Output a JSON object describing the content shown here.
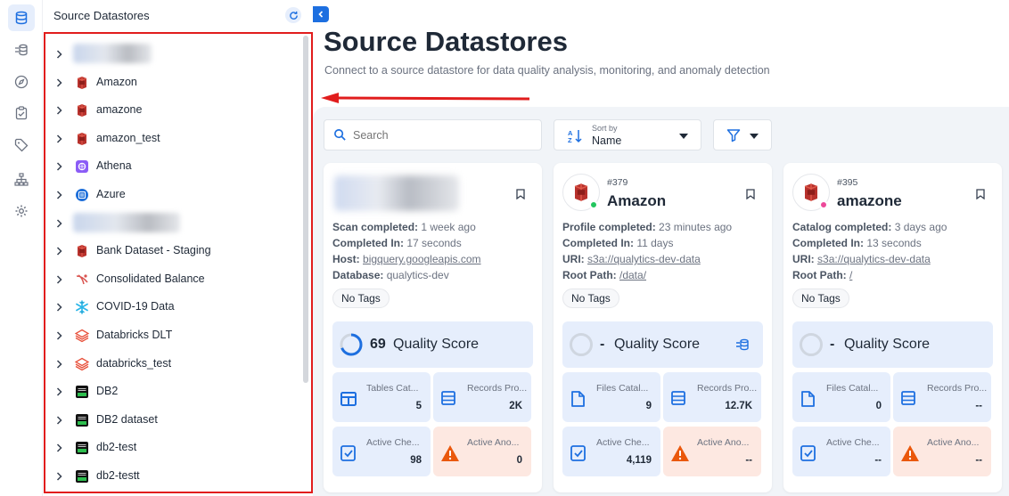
{
  "rail": {
    "items": [
      {
        "icon": "database-icon"
      },
      {
        "icon": "data-flow-icon"
      },
      {
        "icon": "compass-icon"
      },
      {
        "icon": "clipboard-check-icon"
      },
      {
        "icon": "tag-icon"
      },
      {
        "icon": "hierarchy-icon"
      },
      {
        "icon": "settings-gear-icon"
      }
    ]
  },
  "sidebar": {
    "title": "Source Datastores",
    "items": [
      {
        "label": "",
        "icon": "blurred",
        "redacted": true
      },
      {
        "label": "Amazon",
        "icon": "amazon-s3-icon"
      },
      {
        "label": "amazone",
        "icon": "amazon-s3-icon"
      },
      {
        "label": "amazon_test",
        "icon": "amazon-s3-icon"
      },
      {
        "label": "Athena",
        "icon": "athena-icon"
      },
      {
        "label": "Azure",
        "icon": "azure-icon"
      },
      {
        "label": "",
        "icon": "blurred",
        "redacted": true
      },
      {
        "label": "Bank Dataset - Staging",
        "icon": "amazon-s3-icon"
      },
      {
        "label": "Consolidated Balance",
        "icon": "dremio-icon"
      },
      {
        "label": "COVID-19 Data",
        "icon": "snowflake-icon"
      },
      {
        "label": "Databricks DLT",
        "icon": "databricks-icon"
      },
      {
        "label": "databricks_test",
        "icon": "databricks-icon"
      },
      {
        "label": "DB2",
        "icon": "ibm-db2-icon"
      },
      {
        "label": "DB2 dataset",
        "icon": "ibm-db2-icon"
      },
      {
        "label": "db2-test",
        "icon": "ibm-db2-icon"
      },
      {
        "label": "db2-testt",
        "icon": "ibm-db2-icon"
      }
    ]
  },
  "main": {
    "title": "Source Datastores",
    "subtitle": "Connect to a source datastore for data quality analysis, monitoring, and anomaly detection",
    "search": {
      "placeholder": "Search"
    },
    "sort": {
      "label": "Sort by",
      "value": "Name"
    }
  },
  "cards": [
    {
      "number": "",
      "name": "",
      "redacted": true,
      "status_color": "",
      "lines": [
        {
          "key": "Scan completed:",
          "value": "1 week ago",
          "link": false
        },
        {
          "key": "Completed In:",
          "value": "17 seconds",
          "link": false
        },
        {
          "key": "Host:",
          "value": "bigquery.googleapis.com",
          "link": true
        },
        {
          "key": "Database:",
          "value": "qualytics-dev",
          "link": false
        }
      ],
      "tag": "No Tags",
      "quality_value": "69",
      "quality_label": "Quality Score",
      "quality_fraction": 0.69,
      "tiles": [
        {
          "icon": "table-icon",
          "label": "Tables Cat...",
          "value": "5"
        },
        {
          "icon": "records-icon",
          "label": "Records Pro...",
          "value": "2K"
        },
        {
          "icon": "check-icon",
          "label": "Active Che...",
          "value": "98"
        },
        {
          "icon": "warning-icon",
          "label": "Active Ano...",
          "value": "0"
        }
      ]
    },
    {
      "number": "#379",
      "name": "Amazon",
      "redacted": false,
      "status_color": "#22c55e",
      "lines": [
        {
          "key": "Profile completed:",
          "value": "23 minutes ago",
          "link": false
        },
        {
          "key": "Completed In:",
          "value": "11 days",
          "link": false
        },
        {
          "key": "URI:",
          "value": "s3a://qualytics-dev-data",
          "link": true
        },
        {
          "key": "Root Path:",
          "value": "/data/",
          "link": true
        }
      ],
      "tag": "No Tags",
      "quality_value": "-",
      "quality_label": "Quality Score",
      "tiles": [
        {
          "icon": "file-icon",
          "label": "Files Catal...",
          "value": "9"
        },
        {
          "icon": "records-icon",
          "label": "Records Pro...",
          "value": "12.7K"
        },
        {
          "icon": "check-icon",
          "label": "Active Che...",
          "value": "4,119"
        },
        {
          "icon": "warning-icon",
          "label": "Active Ano...",
          "value": "--"
        }
      ]
    },
    {
      "number": "#395",
      "name": "amazone",
      "redacted": false,
      "status_color": "#ec4899",
      "lines": [
        {
          "key": "Catalog completed:",
          "value": "3 days ago",
          "link": false
        },
        {
          "key": "Completed In:",
          "value": "13 seconds",
          "link": false
        },
        {
          "key": "URI:",
          "value": "s3a://qualytics-dev-data",
          "link": true
        },
        {
          "key": "Root Path:",
          "value": "/",
          "link": true
        }
      ],
      "tag": "No Tags",
      "quality_value": "-",
      "quality_label": "Quality Score",
      "tiles": [
        {
          "icon": "file-icon",
          "label": "Files Catal...",
          "value": "0"
        },
        {
          "icon": "records-icon",
          "label": "Records Pro...",
          "value": "--"
        },
        {
          "icon": "check-icon",
          "label": "Active Che...",
          "value": "--"
        },
        {
          "icon": "warning-icon",
          "label": "Active Ano...",
          "value": "--"
        }
      ]
    }
  ],
  "colors": {
    "accent": "#1d6fe0",
    "highlight_box": "#e11d1d",
    "warning": "#f97316"
  }
}
